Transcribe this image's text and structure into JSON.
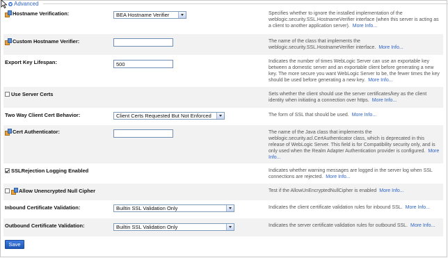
{
  "section": {
    "title": "Advanced"
  },
  "settings": [
    {
      "label": "Hostname Verification:",
      "control": "select",
      "value": "BEA Hostname Verifier",
      "desc": "Specifies whether to ignore the installed implementation of the weblogic.security.SSL.HostnameVerifier interface (when this server is acting as a client to another application server).",
      "more": "More Info..."
    },
    {
      "label": "Custom Hostname Verifier:",
      "control": "text",
      "value": "",
      "desc": "The name of the class that implements the weblogic.security.SSL.HostnameVerifier interface.",
      "more": "More Info..."
    },
    {
      "label": "Export Key Lifespan:",
      "control": "text",
      "value": "500",
      "desc": "Indicates the number of times WebLogic Server can use an exportable key between a domestic server and an exportable client before generating a new key. The more secure you want WebLogic Server to be, the fewer times the key should be used before generating a new key.",
      "more": "More Info..."
    },
    {
      "label": "Use Server Certs",
      "control": "checkbox",
      "checked": false,
      "desc": "Sets whether the client should use the server certificates/key as the client identity when initiating a connection over https.",
      "more": "More Info..."
    },
    {
      "label": "Two Way Client Cert Behavior:",
      "control": "select",
      "value": "Client Certs Requested But Not Enforced",
      "desc": "The form of SSL that should be used.",
      "more": "More Info..."
    },
    {
      "label": "Cert Authenticator:",
      "control": "text",
      "value": "",
      "desc": "The name of the Java class that implements the weblogic.security.acl.CertAuthenticator class, which is deprecated in this release of WebLogic Server. This field is for Compatibility security only, and is only used when the Realm Adapter Authentication provider is configured.",
      "more": "More Info..."
    },
    {
      "label": "SSLRejection Logging Enabled",
      "control": "checkbox",
      "checked": true,
      "desc": "Indicates whether warning messages are logged in the server log when SSL connections are rejected.",
      "more": "More Info..."
    },
    {
      "label": "Allow Unencrypted Null Cipher",
      "control": "checkbox",
      "checked": false,
      "desc": "Test if the AllowUnEncryptedNullCipher is enabled",
      "more": "More Info..."
    },
    {
      "label": "Inbound Certificate Validation:",
      "control": "select",
      "value": "Builtin SSL Validation Only",
      "desc": "Indicates the client certificate validation rules for inbound SSL.",
      "more": "More Info..."
    },
    {
      "label": "Outbound Certificate Validation:",
      "control": "select",
      "value": "Builtin SSL Validation Only",
      "desc": "Indicates the server certificate validation rules for outbound SSL.",
      "more": "More Info..."
    }
  ],
  "actions": {
    "save": "Save"
  }
}
